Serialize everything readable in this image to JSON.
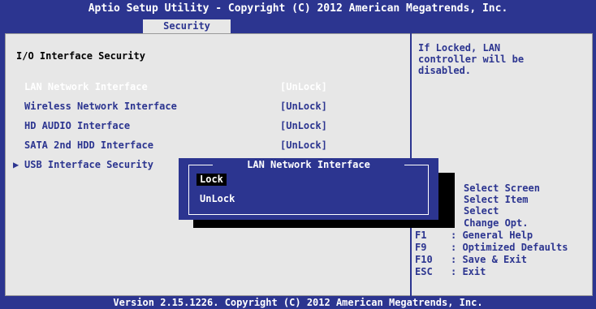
{
  "header": {
    "title": "Aptio Setup Utility - Copyright (C) 2012 American Megatrends, Inc.",
    "active_tab": "Security"
  },
  "section": {
    "title": "I/O Interface Security"
  },
  "items": [
    {
      "label": "LAN Network Interface",
      "value": "[UnLock]"
    },
    {
      "label": "Wireless Network Interface",
      "value": "[UnLock]"
    },
    {
      "label": "HD AUDIO Interface",
      "value": "[UnLock]"
    },
    {
      "label": "SATA 2nd HDD Interface",
      "value": "[UnLock]"
    },
    {
      "label": "USB Interface Security",
      "value": ""
    }
  ],
  "help": {
    "description": [
      "If Locked, LAN",
      "controller will be",
      "disabled."
    ],
    "keys": [
      {
        "key": "",
        "text": "Select Screen"
      },
      {
        "key": "",
        "text": "Select Item"
      },
      {
        "key": "",
        "text": "Select"
      },
      {
        "key": "",
        "text": "Change Opt."
      },
      {
        "key": "F1",
        "text": ": General Help"
      },
      {
        "key": "F9",
        "text": ": Optimized Defaults"
      },
      {
        "key": "F10",
        "text": ": Save & Exit"
      },
      {
        "key": "ESC",
        "text": ": Exit"
      }
    ]
  },
  "popup": {
    "title": "LAN Network Interface",
    "options": [
      "Lock",
      "UnLock"
    ]
  },
  "footer": {
    "version": "Version 2.15.1226. Copyright (C) 2012 American Megatrends, Inc."
  },
  "colors": {
    "background": "#2c3590",
    "panel": "#e7e7e7",
    "highlight_text": "#ffffff"
  }
}
